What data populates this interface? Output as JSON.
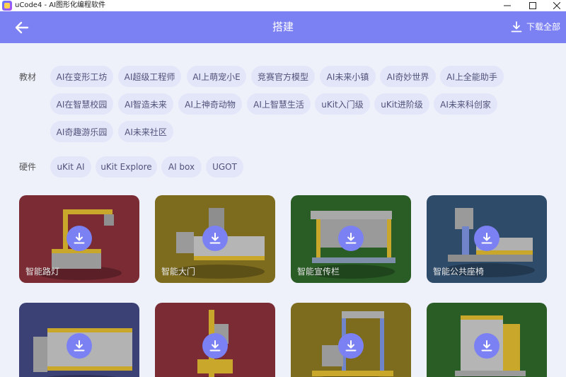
{
  "window": {
    "title": "uCode4 - AI图形化编程软件",
    "min_icon": "minimize-icon",
    "max_icon": "maximize-icon",
    "close_icon": "close-icon"
  },
  "header": {
    "title": "搭建",
    "back_icon": "arrow-left-icon",
    "download_all_label": "下载全部",
    "download_icon": "download-icon",
    "bg_color": "#7b80f3"
  },
  "filters": {
    "textbook": {
      "label": "教材",
      "chips": [
        "AI在变形工坊",
        "AI超级工程师",
        "AI上萌宠小E",
        "竞赛官方模型",
        "AI未来小镇",
        "AI奇妙世界",
        "AI上全能助手",
        "AI在智慧校园",
        "AI智造未来",
        "AI上神奇动物",
        "AI上智慧生活",
        "uKit入门级",
        "uKit进阶级",
        "AI未来科创家",
        "AI奇趣游乐园",
        "AI未来社区"
      ]
    },
    "hardware": {
      "label": "硬件",
      "chips": [
        "uKit AI",
        "uKit Explore",
        "AI box",
        "UGOT"
      ]
    }
  },
  "cards": [
    {
      "name": "智能路灯",
      "color": "#7a2b34"
    },
    {
      "name": "智能大门",
      "color": "#7d6b1e"
    },
    {
      "name": "智能宣传栏",
      "color": "#2a5c26"
    },
    {
      "name": "智能公共座椅",
      "color": "#2e4b6a"
    },
    {
      "name": "",
      "color": "#3b4175"
    },
    {
      "name": "",
      "color": "#7a2b34"
    },
    {
      "name": "",
      "color": "#7d6b1e"
    },
    {
      "name": "",
      "color": "#2a5c26"
    }
  ]
}
